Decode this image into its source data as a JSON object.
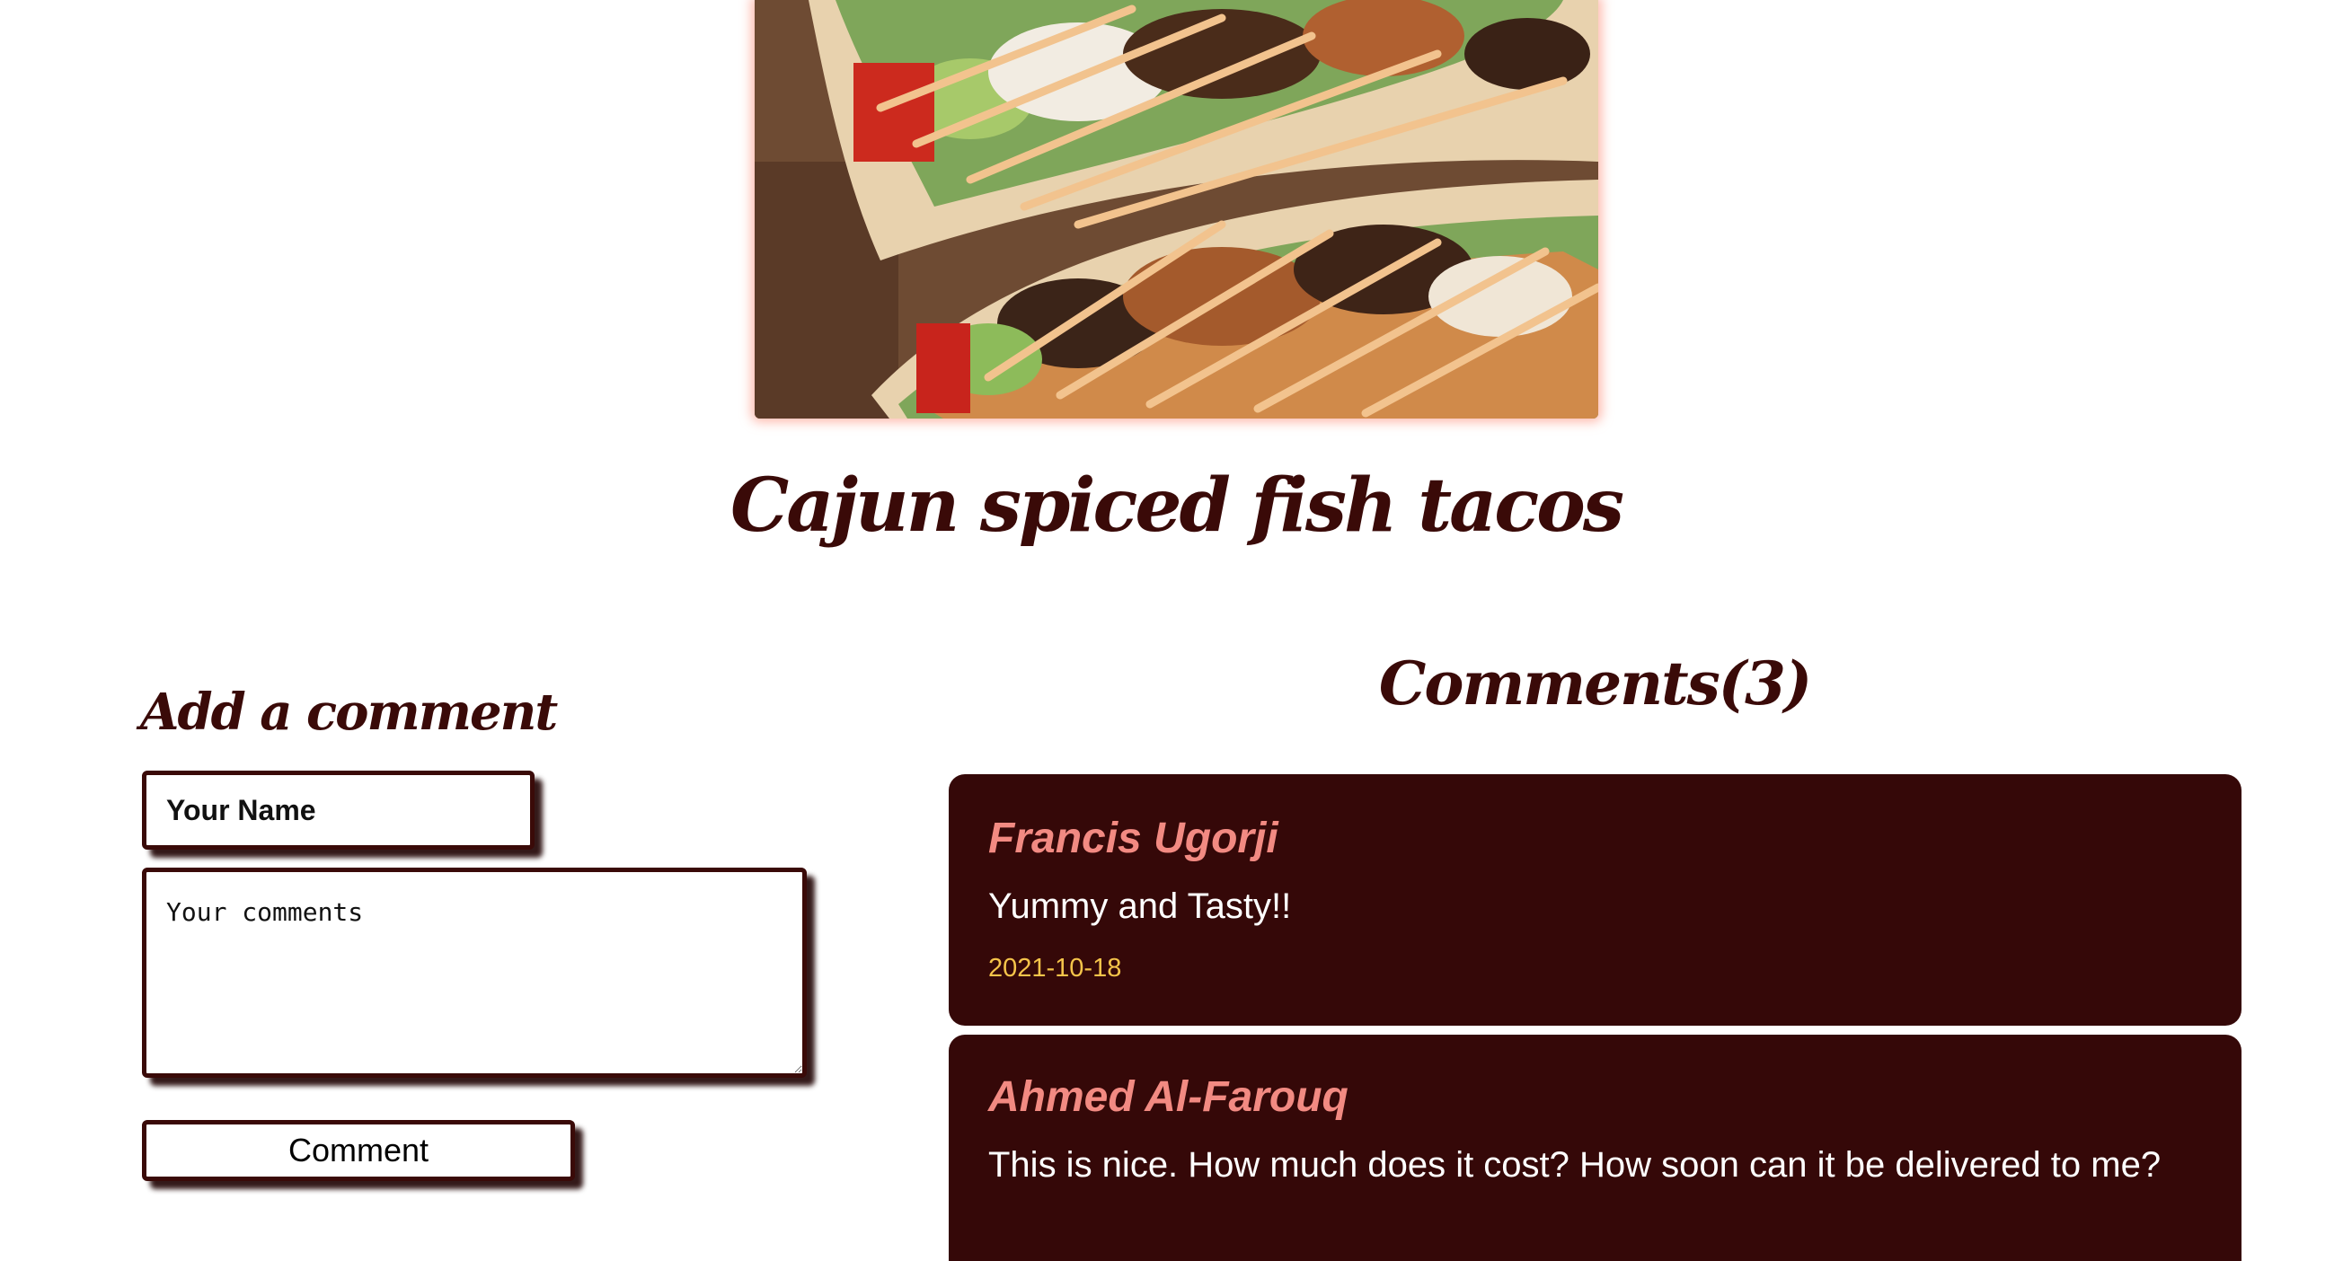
{
  "recipe": {
    "image_alt": "Cajun spiced fish tacos photo",
    "title": "Cajun spiced fish tacos"
  },
  "add_comment": {
    "heading": "Add a comment",
    "name_placeholder": "Your Name",
    "comments_placeholder": "Your comments",
    "button_label": "Comment"
  },
  "comments": {
    "heading": "Comments(3)",
    "items": [
      {
        "author": "Francis Ugorji",
        "text": "Yummy and Tasty!!",
        "date": "2021-10-18"
      },
      {
        "author": "Ahmed Al-Farouq",
        "text": "This is nice. How much does it cost? How soon can it be delivered to me?"
      }
    ]
  },
  "colors": {
    "heading": "#3a0a08",
    "card_background": "#350808",
    "author": "#f28a82",
    "date": "#f5c44a",
    "image_glow": "#ff9682"
  }
}
